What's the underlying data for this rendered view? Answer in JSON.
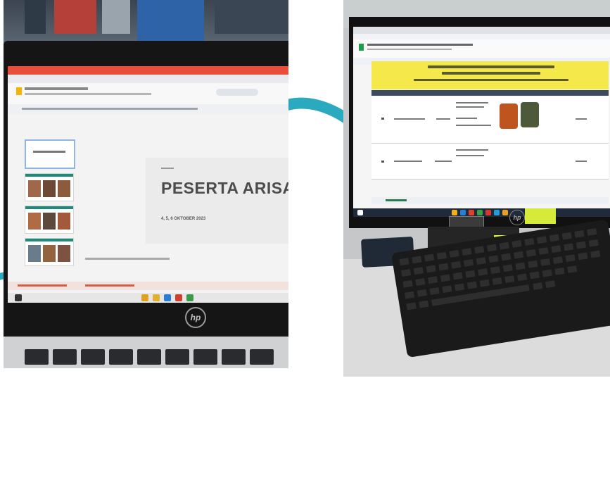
{
  "left_photo": {
    "slide_title": "PESERTA ARISAN",
    "slide_subtitle": "4, 5, 6 OKTOBER 2023",
    "laptop_logo": "hp"
  },
  "right_photo": {
    "laptop_logo": "hp"
  },
  "colors": {
    "teal_swoosh": "#2aa9bf",
    "sheet_header_yellow": "#f4e84a",
    "sticky_note": "#d6ea3c",
    "browser_tab_red": "#e84e3a"
  }
}
